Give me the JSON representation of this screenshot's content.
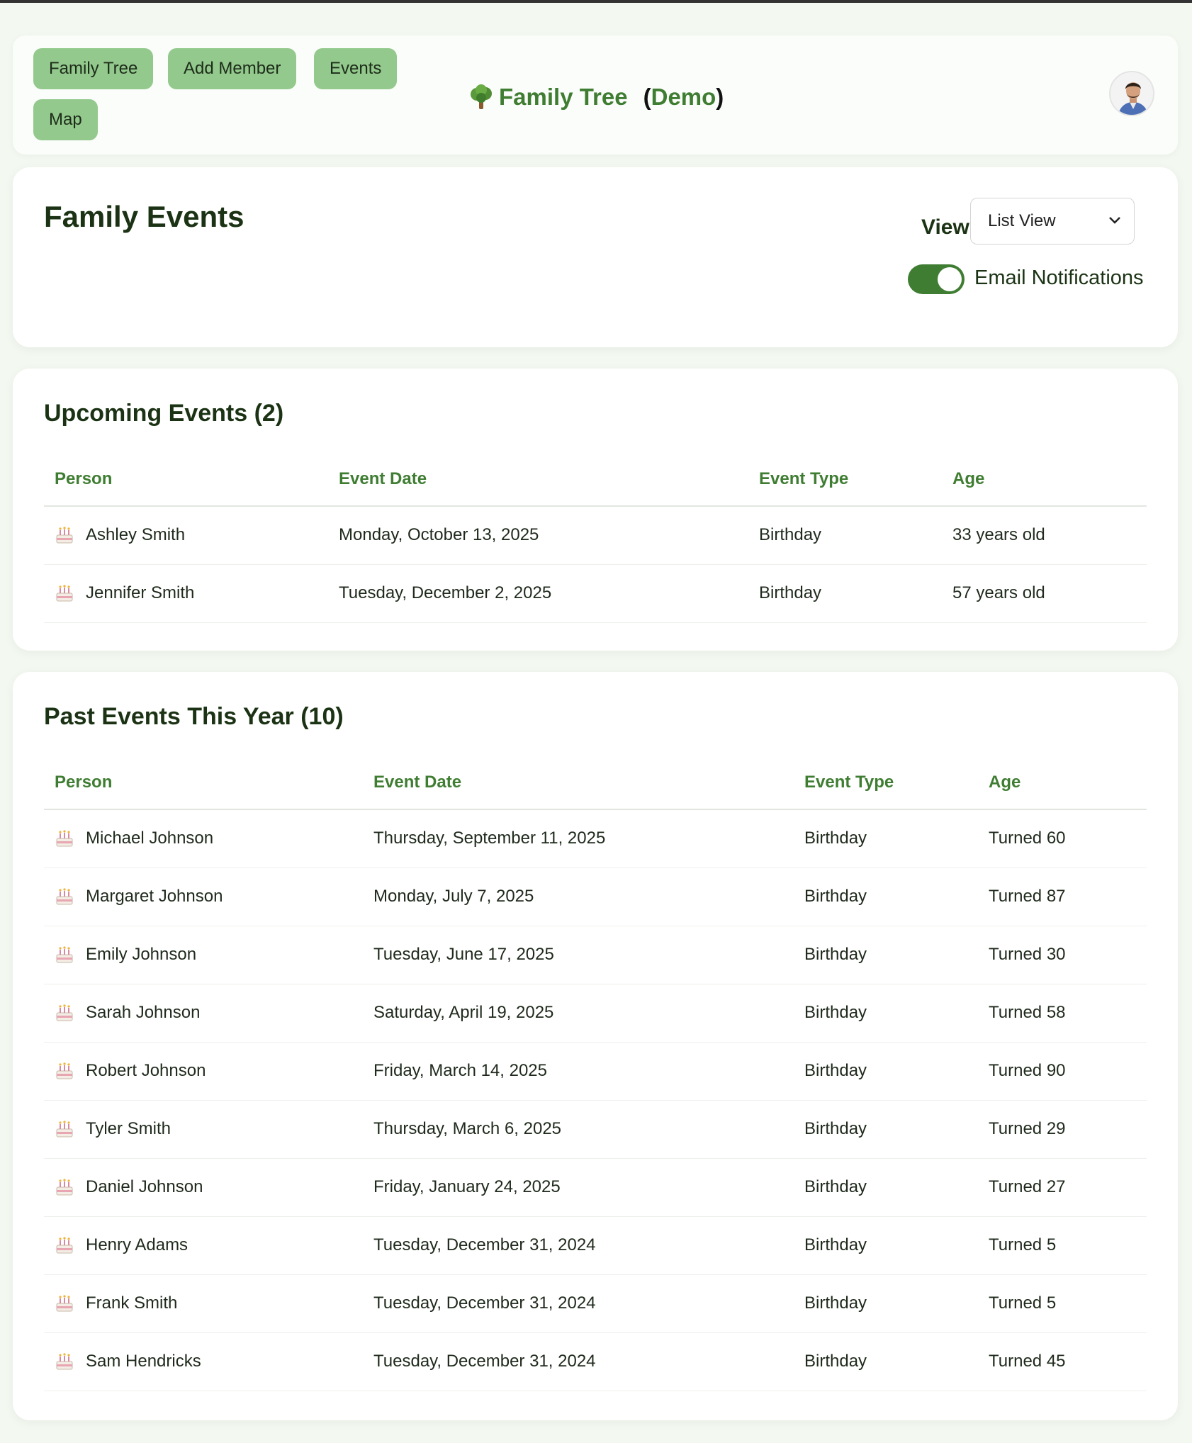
{
  "header": {
    "nav": [
      "Family Tree",
      "Add Member",
      "Events",
      "Map"
    ],
    "brand_title": "Family Tree",
    "brand_paren_open": "(",
    "brand_demo": "Demo",
    "brand_paren_close": ")",
    "brand_icon": "tree-icon",
    "avatar_icon": "user-avatar"
  },
  "controls": {
    "page_title": "Family Events",
    "view_label": "View:",
    "view_selected": "List View",
    "email_notifications_label": "Email Notifications",
    "email_notifications_on": true
  },
  "upcoming": {
    "title": "Upcoming Events (2)",
    "columns": [
      "Person",
      "Event Date",
      "Event Type",
      "Age"
    ],
    "rows": [
      {
        "person": "Ashley Smith",
        "date": "Monday, October 13, 2025",
        "type": "Birthday",
        "age": "33 years old"
      },
      {
        "person": "Jennifer Smith",
        "date": "Tuesday, December 2, 2025",
        "type": "Birthday",
        "age": "57 years old"
      }
    ]
  },
  "past": {
    "title": "Past Events This Year (10)",
    "columns": [
      "Person",
      "Event Date",
      "Event Type",
      "Age"
    ],
    "rows": [
      {
        "person": "Michael Johnson",
        "date": "Thursday, September 11, 2025",
        "type": "Birthday",
        "age": "Turned 60"
      },
      {
        "person": "Margaret Johnson",
        "date": "Monday, July 7, 2025",
        "type": "Birthday",
        "age": "Turned 87"
      },
      {
        "person": "Emily Johnson",
        "date": "Tuesday, June 17, 2025",
        "type": "Birthday",
        "age": "Turned 30"
      },
      {
        "person": "Sarah Johnson",
        "date": "Saturday, April 19, 2025",
        "type": "Birthday",
        "age": "Turned 58"
      },
      {
        "person": "Robert Johnson",
        "date": "Friday, March 14, 2025",
        "type": "Birthday",
        "age": "Turned 90"
      },
      {
        "person": "Tyler Smith",
        "date": "Thursday, March 6, 2025",
        "type": "Birthday",
        "age": "Turned 29"
      },
      {
        "person": "Daniel Johnson",
        "date": "Friday, January 24, 2025",
        "type": "Birthday",
        "age": "Turned 27"
      },
      {
        "person": "Henry Adams",
        "date": "Tuesday, December 31, 2024",
        "type": "Birthday",
        "age": "Turned 5"
      },
      {
        "person": "Frank Smith",
        "date": "Tuesday, December 31, 2024",
        "type": "Birthday",
        "age": "Turned 5"
      },
      {
        "person": "Sam Hendricks",
        "date": "Tuesday, December 31, 2024",
        "type": "Birthday",
        "age": "Turned 45"
      }
    ]
  },
  "colors": {
    "accent": "#3f7d32",
    "nav_button": "#93c98c",
    "background": "#f3f8f1"
  }
}
